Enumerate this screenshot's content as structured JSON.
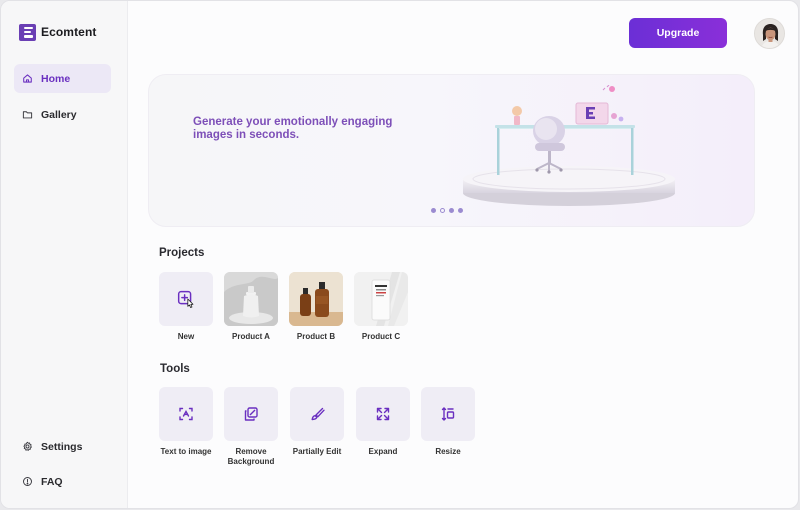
{
  "brand": {
    "name": "Ecomtent"
  },
  "sidebar": {
    "items": [
      {
        "label": "Home",
        "icon": "home-icon",
        "active": true
      },
      {
        "label": "Gallery",
        "icon": "folder-icon",
        "active": false
      }
    ],
    "bottom_items": [
      {
        "label": "Settings",
        "icon": "gear-icon"
      },
      {
        "label": "FAQ",
        "icon": "help-icon"
      }
    ]
  },
  "header": {
    "upgrade_label": "Upgrade",
    "avatar": "user-avatar"
  },
  "hero": {
    "headline": "Generate your emotionally engaging images in seconds.",
    "carousel_total": 4,
    "carousel_active": 1
  },
  "projects": {
    "title": "Projects",
    "items": [
      {
        "label": "New",
        "icon": "add-cursor-icon"
      },
      {
        "label": "Product A",
        "thumb": "product-a-thumbnail"
      },
      {
        "label": "Product B",
        "thumb": "product-b-thumbnail"
      },
      {
        "label": "Product C",
        "thumb": "product-c-thumbnail"
      }
    ]
  },
  "tools": {
    "title": "Tools",
    "items": [
      {
        "label": "Text to image",
        "icon": "scan-text-icon"
      },
      {
        "label": "Remove Background",
        "icon": "layers-icon"
      },
      {
        "label": "Partially Edit",
        "icon": "brush-icon"
      },
      {
        "label": "Expand",
        "icon": "expand-icon"
      },
      {
        "label": "Resize",
        "icon": "resize-icon"
      }
    ]
  },
  "colors": {
    "accent": "#6a2fc0",
    "upgrade_start": "#6b2fd6",
    "upgrade_end": "#8a2fd9",
    "hero_text": "#7d4fb8",
    "card_bg": "#efedf5",
    "active_nav_bg": "#ece8f6"
  }
}
